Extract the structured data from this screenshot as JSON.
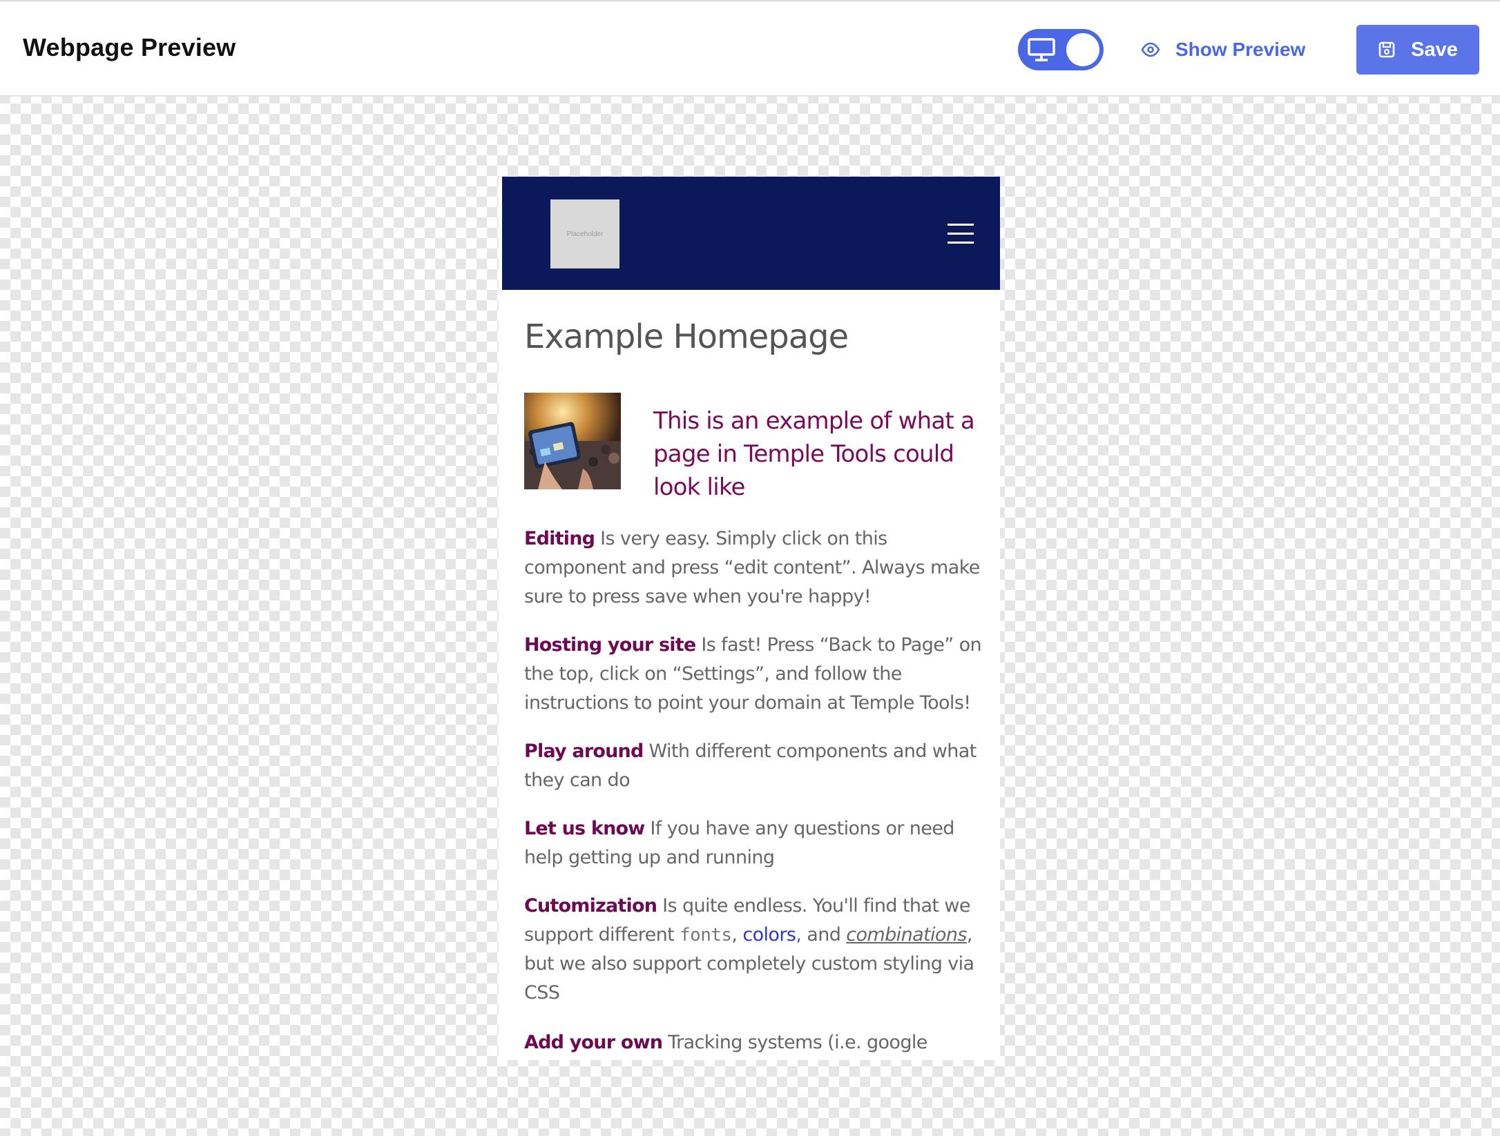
{
  "topbar": {
    "title": "Webpage Preview",
    "show_preview_label": "Show Preview",
    "save_label": "Save",
    "toggle_icon": "monitor-icon",
    "accent_color": "#4a67e6"
  },
  "preview": {
    "logo_placeholder": "Placeholder",
    "header_color": "#0b185a",
    "page_title": "Example Homepage",
    "hero_text": "This is an example of what a page in Temple Tools could look like",
    "hero_image": "concert-tablet-photo",
    "paragraphs": [
      {
        "keyword": "Editing",
        "text": " Is very easy. Simply click on this component and press “edit content”. Always make sure to press save when you're happy!"
      },
      {
        "keyword": "Hosting your site",
        "text": " Is fast! Press “Back to Page” on the top, click on “Settings”, and follow the instructions to point your domain at Temple Tools!"
      },
      {
        "keyword": "Play around",
        "text": " With different components and what they can do"
      },
      {
        "keyword": "Let us know",
        "text": " If you have any questions or need help getting up and running"
      },
      {
        "keyword": "Cutomization",
        "text_a": " Is quite endless. You'll find that we support different ",
        "fonts": "fonts",
        "sep1": ", ",
        "colors": "colors",
        "sep2": ", and ",
        "combinations": "combinations",
        "text_b": ", but we also support completely custom styling via CSS"
      },
      {
        "keyword": "Add your own",
        "text": " Tracking systems (i.e. google"
      }
    ]
  }
}
